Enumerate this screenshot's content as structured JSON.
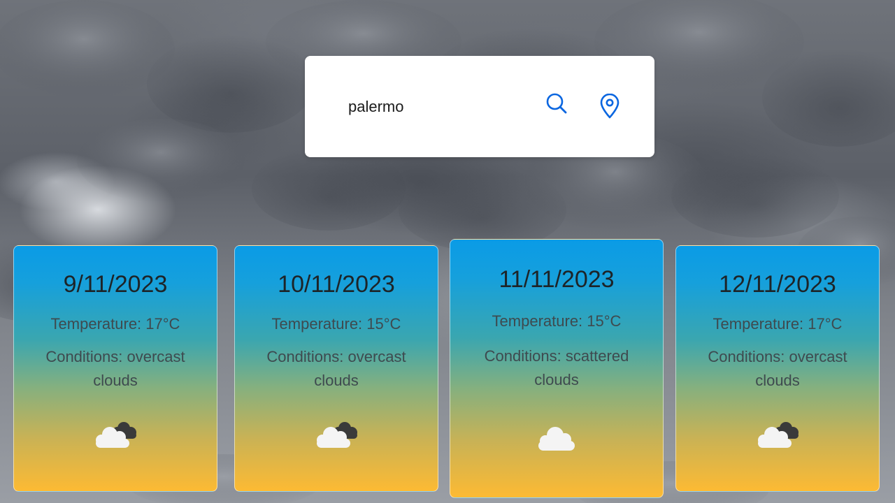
{
  "search": {
    "value": "palermo"
  },
  "forecast": [
    {
      "date": "9/11/2023",
      "temperature": "Temperature: 17°C",
      "conditions_line1": "Conditions: overcast",
      "conditions_line2": "clouds",
      "icon": "broken-clouds-icon"
    },
    {
      "date": "10/11/2023",
      "temperature": "Temperature: 15°C",
      "conditions_line1": "Conditions: overcast",
      "conditions_line2": "clouds",
      "icon": "broken-clouds-icon"
    },
    {
      "date": "11/11/2023",
      "temperature": "Temperature: 15°C",
      "conditions_line1": "Conditions: scattered",
      "conditions_line2": "clouds",
      "icon": "cloud-icon"
    },
    {
      "date": "12/11/2023",
      "temperature": "Temperature: 17°C",
      "conditions_line1": "Conditions: overcast",
      "conditions_line2": "clouds",
      "icon": "broken-clouds-icon"
    }
  ],
  "colors": {
    "accent": "#0a66e0",
    "card_top": "#0a9be6",
    "card_bottom": "#fdba33"
  }
}
